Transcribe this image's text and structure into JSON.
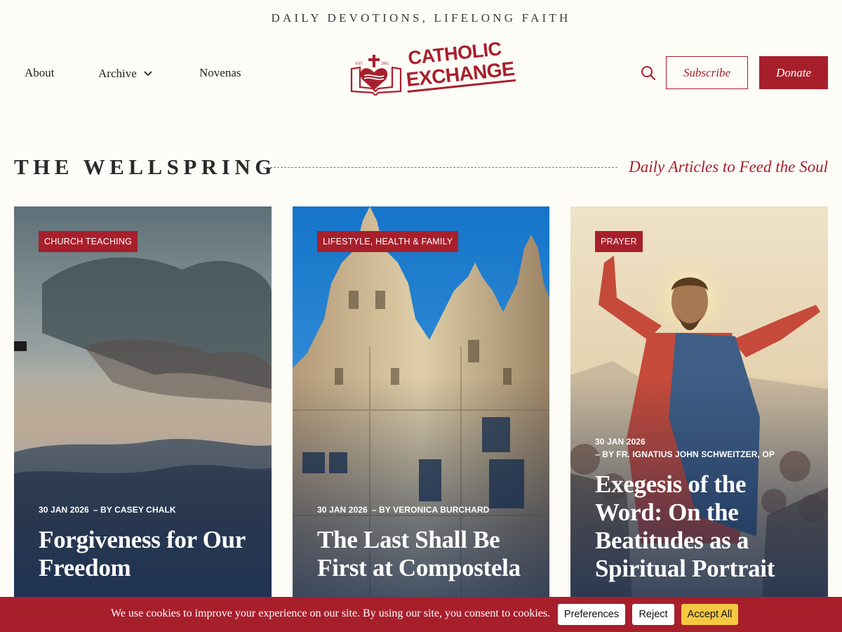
{
  "header": {
    "tagline": "DAILY DEVOTIONS, LIFELONG FAITH",
    "nav": [
      {
        "label": "About"
      },
      {
        "label": "Archive",
        "has_dropdown": true
      },
      {
        "label": "Novenas"
      }
    ],
    "logo": {
      "line1": "CATHOLIC",
      "line2": "EXCHANGE",
      "est_text": "EST.",
      "est_year": "2001"
    },
    "search_icon": "search-icon",
    "subscribe_label": "Subscribe",
    "donate_label": "Donate"
  },
  "section": {
    "title": "THE WELLSPRING",
    "subtitle": "Daily Articles to Feed the Soul"
  },
  "cards": [
    {
      "category": "CHURCH TEACHING",
      "date": "30 JAN 2026",
      "author": "– BY CASEY CHALK",
      "title": "Forgiveness for Our Freedom",
      "image": "sunset-clouds-over-mountains"
    },
    {
      "category": "LIFESTYLE, HEALTH & FAMILY",
      "date": "30 JAN 2026",
      "author": "– BY VERONICA BURCHARD",
      "title": "The Last Shall Be First at Compostela",
      "image": "cathedral-facade-blue-sky"
    },
    {
      "category": "PRAYER",
      "date": "30 JAN 2026",
      "author": "– BY FR. IGNATIUS JOHN SCHWEITZER, OP",
      "title": "Exegesis of the Word: On the Beatitudes as a Spiritual Portrait",
      "image": "christ-preaching-painting"
    }
  ],
  "cookie": {
    "text": "We use cookies to improve your experience on our site. By using our site, you consent to cookies.",
    "preferences_label": "Preferences",
    "reject_label": "Reject",
    "accept_label": "Accept All"
  },
  "colors": {
    "brand": "#a81f2c",
    "background": "#fdfcf7",
    "accept_button": "#f5c842"
  }
}
